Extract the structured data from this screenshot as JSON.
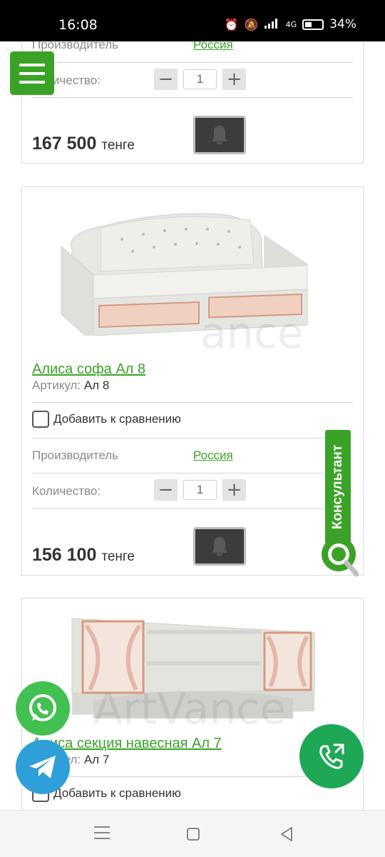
{
  "status_bar": {
    "time": "16:08",
    "network": "4G",
    "battery": "34%"
  },
  "products": [
    {
      "maker_label": "Производитель",
      "maker_value": "Россия",
      "qty_label": "Количество:",
      "qty_value": "1",
      "price_value": "167 500",
      "price_currency": "тенге"
    },
    {
      "title": "Алиса софа Ал 8",
      "sku_label": "Артикул:",
      "sku_value": "Ал 8",
      "compare_label": "Добавить к сравнению",
      "maker_label": "Производитель",
      "maker_value": "Россия",
      "qty_label": "Количество:",
      "qty_value": "1",
      "price_value": "156 100",
      "price_currency": "тенге"
    },
    {
      "title": "Алиса секция навесная Ал 7",
      "sku_label": "Артикул:",
      "sku_value": "Ал 7",
      "compare_label": "Добавить к сравнению"
    }
  ],
  "widgets": {
    "consultant_label": "Консультант"
  },
  "colors": {
    "accent_green": "#3aa327",
    "call_green": "#1ea856",
    "whatsapp_green": "#43c052",
    "telegram_blue": "#2e9fd8",
    "bell_button": "#3c3c3c"
  },
  "icons": [
    "menu-icon",
    "bell-icon",
    "minus-icon",
    "plus-icon",
    "whatsapp-icon",
    "telegram-icon",
    "phone-icon",
    "search-icon"
  ]
}
